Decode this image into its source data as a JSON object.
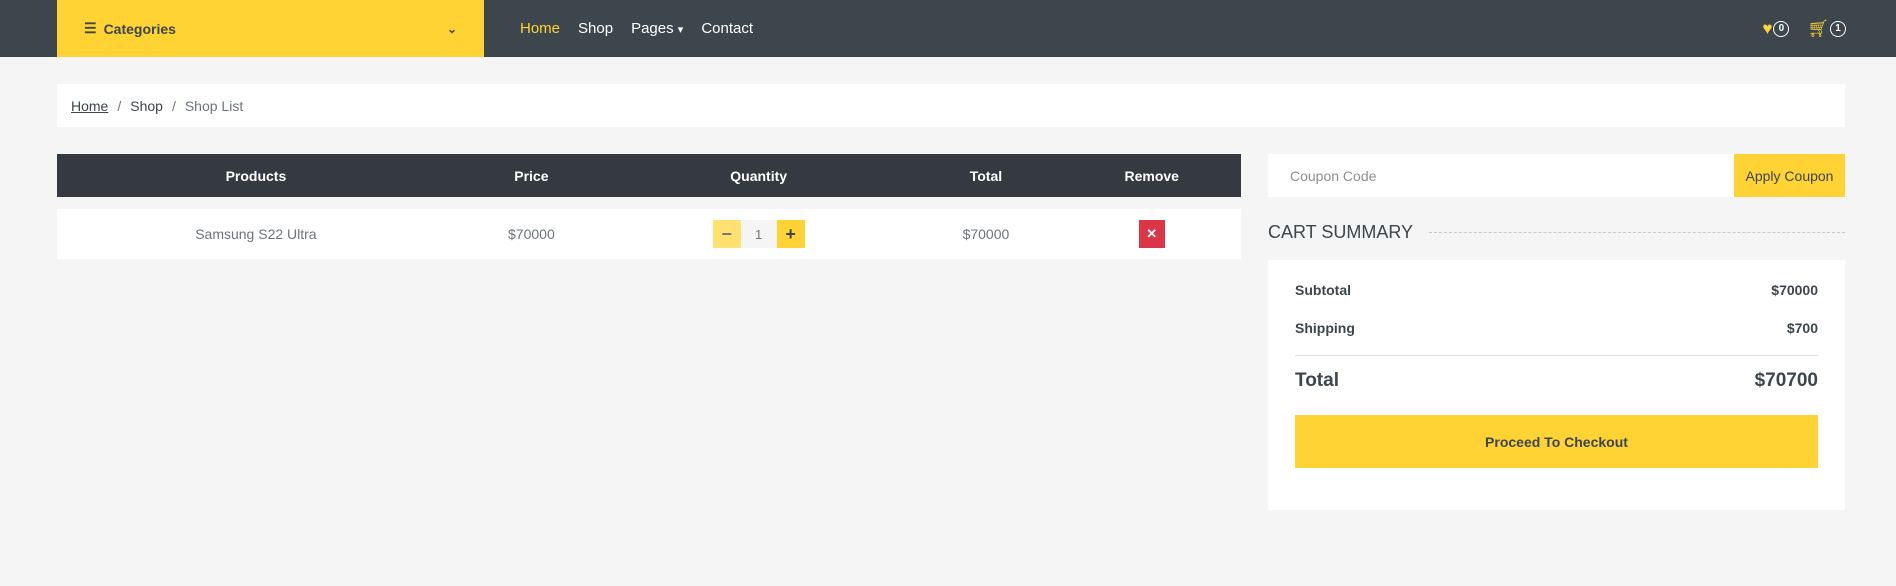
{
  "nav": {
    "categories": "Categories",
    "links": [
      "Home",
      "Shop",
      "Pages",
      "Contact"
    ],
    "wishlist_count": "0",
    "cart_count": "1"
  },
  "breadcrumb": [
    "Home",
    "Shop",
    "Shop List"
  ],
  "cart_table": {
    "headers": [
      "Products",
      "Price",
      "Quantity",
      "Total",
      "Remove"
    ],
    "rows": [
      {
        "product": "Samsung S22 Ultra",
        "price": "$70000",
        "quantity": "1",
        "total": "$70000"
      }
    ]
  },
  "coupon": {
    "placeholder": "Coupon Code",
    "button": "Apply Coupon"
  },
  "summary": {
    "title": "CART SUMMARY",
    "subtotal_label": "Subtotal",
    "subtotal": "$70000",
    "shipping_label": "Shipping",
    "shipping": "$700",
    "total_label": "Total",
    "total": "$70700",
    "checkout": "Proceed To Checkout"
  },
  "colors": {
    "accent": "#ffd333",
    "dark": "#3d464d",
    "danger": "#dc3545"
  }
}
